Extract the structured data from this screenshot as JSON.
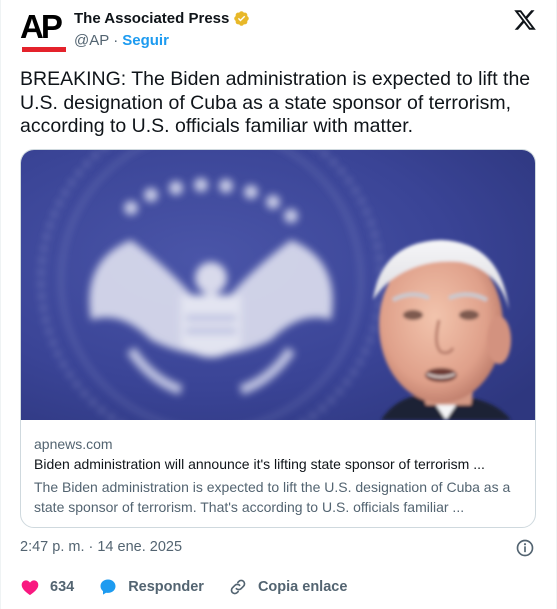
{
  "account": {
    "display_name": "The Associated Press",
    "handle": "@AP",
    "separator": "·",
    "follow_label": "Seguir",
    "avatar_text": "AP",
    "brand_color": "#e4222b",
    "verified_color": "#e8b829"
  },
  "tweet": {
    "text": "BREAKING: The Biden administration is expected to lift the U.S. designation of Cuba as a state sponsor of terrorism, according to U.S. officials familiar with matter."
  },
  "link_card": {
    "domain": "apnews.com",
    "title": "Biden administration will announce it's lifting state sponsor of terrorism ...",
    "description": "The Biden administration is expected to lift the U.S. designation of Cuba as a state sponsor of terrorism. That's according to U.S. officials familiar ..."
  },
  "timestamp": "2:47 p. m. · 14 ene. 2025",
  "actions": {
    "like_count": "634",
    "reply_label": "Responder",
    "copy_link_label": "Copia enlace"
  },
  "colors": {
    "accent": "#1d9bf0",
    "like": "#f91880",
    "muted": "#536471"
  }
}
